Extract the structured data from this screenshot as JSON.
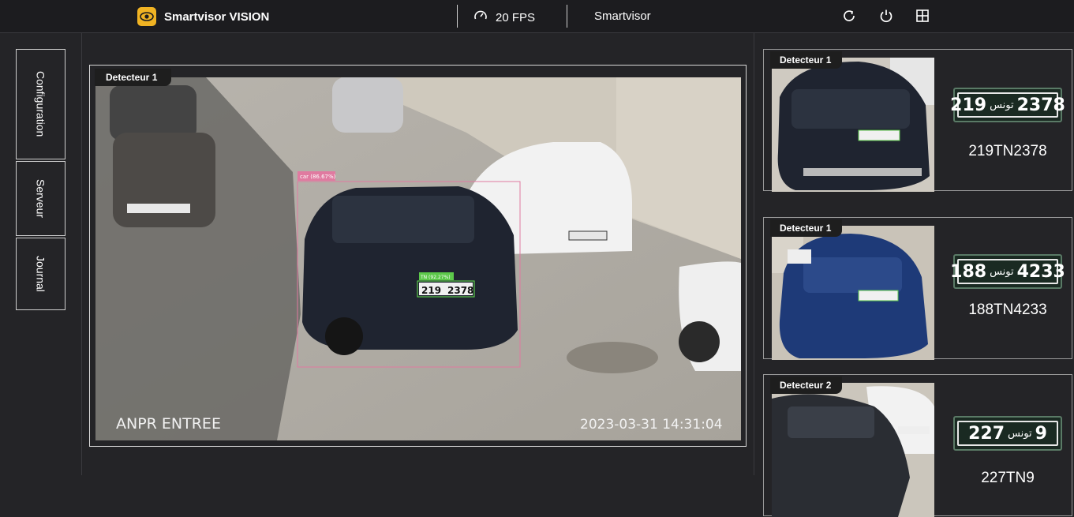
{
  "header": {
    "app_title": "Smartvisor VISION",
    "fps": "20 FPS",
    "user": "Smartvisor"
  },
  "nav": {
    "items": [
      {
        "label": "Configuration"
      },
      {
        "label": "Serveur"
      },
      {
        "label": "Journal"
      }
    ]
  },
  "main": {
    "detector_label": "Detecteur 1",
    "overlay_location": "ANPR ENTREE",
    "overlay_timestamp": "2023-03-31 14:31:04",
    "detection_label": "car (86.67%)",
    "plate_label": "TN (92.27%)",
    "plate_number_left": "219",
    "plate_number_right": "2378"
  },
  "detections": [
    {
      "detector": "Detecteur 1",
      "plate_left": "219",
      "plate_arabic": "تونس",
      "plate_right": "2378",
      "plate_text": "219TN2378",
      "car_color": "#1f2430"
    },
    {
      "detector": "Detecteur 1",
      "plate_left": "188",
      "plate_arabic": "تونس",
      "plate_right": "4233",
      "plate_text": "188TN4233",
      "car_color": "#1e3a78"
    },
    {
      "detector": "Detecteur 2",
      "plate_left": "227",
      "plate_arabic": "تونس",
      "plate_right": "9",
      "plate_text": "227TN9",
      "car_color": "#2a2d33"
    }
  ],
  "colors": {
    "brand": "#f0b323",
    "detection_box": "#e07aa0",
    "plate_box": "#5cc94a"
  },
  "icons": [
    "eye-logo-icon",
    "speedometer-icon",
    "refresh-icon",
    "power-icon",
    "grid-icon"
  ]
}
